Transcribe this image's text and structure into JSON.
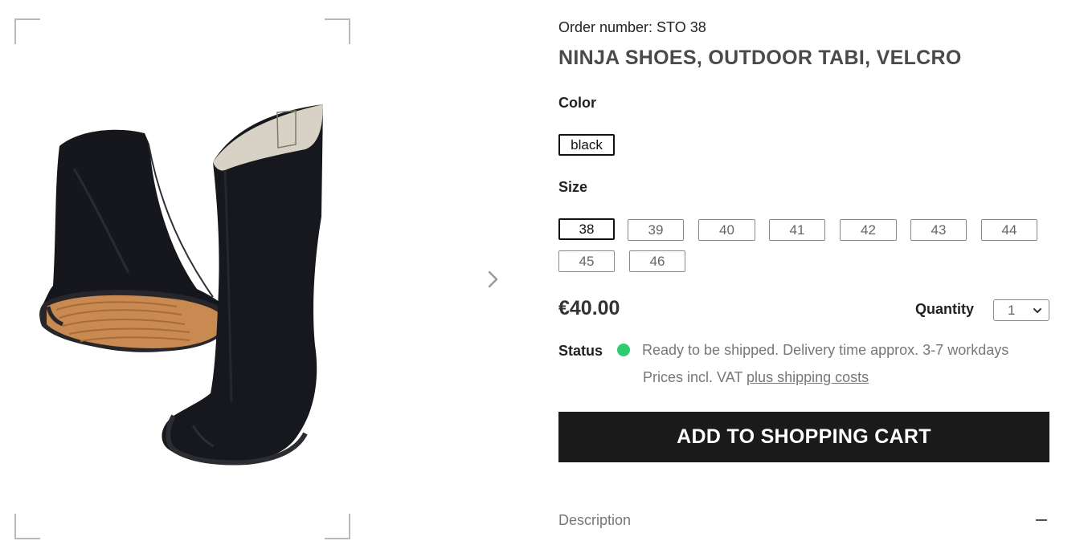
{
  "product": {
    "order_number": "Order number: STO 38",
    "title": "NINJA SHOES, OUTDOOR TABI, VELCRO",
    "image_icon": "tabi-boots-image",
    "color_label": "Color",
    "colors": [
      "black"
    ],
    "selected_color": "black",
    "size_label": "Size",
    "sizes": [
      "38",
      "39",
      "40",
      "41",
      "42",
      "43",
      "44",
      "45",
      "46"
    ],
    "selected_size": "38",
    "price": "€40.00",
    "quantity_label": "Quantity",
    "quantity_value": "1",
    "status_label": "Status",
    "status_color": "#2ecc71",
    "status_text": "Ready to be shipped. Delivery time approx. 3-7 workdays",
    "vat_prefix": "Prices incl. VAT",
    "shipping_link": "plus shipping costs",
    "cart_button": "ADD TO SHOPPING CART",
    "cart_button_color": "#1a1a1a",
    "description_label": "Description"
  }
}
